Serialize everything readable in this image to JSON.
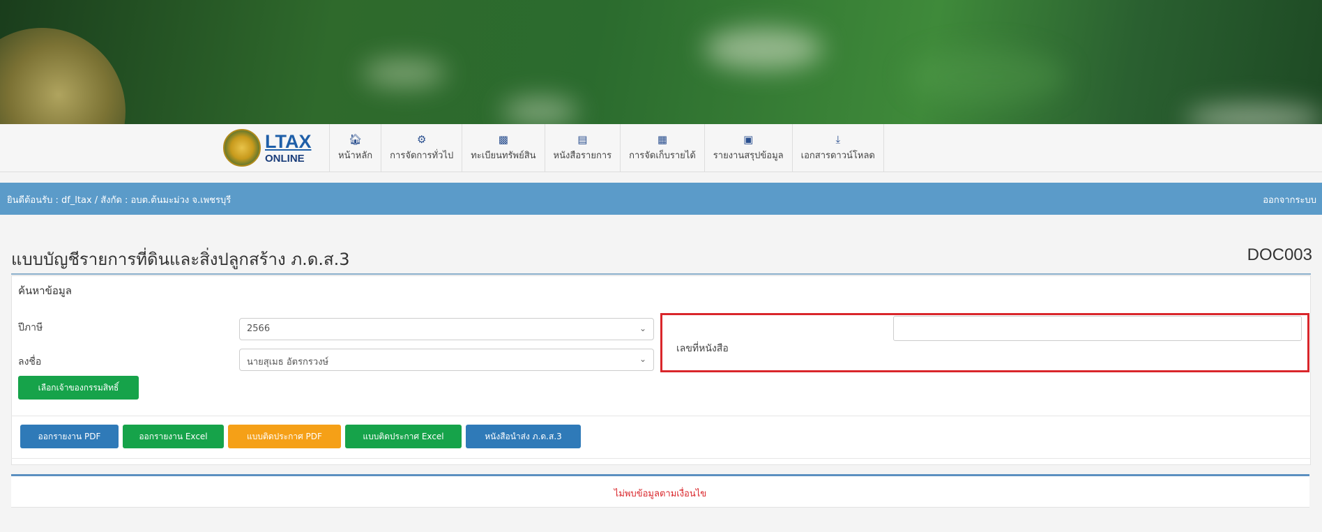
{
  "app": {
    "logo_text": "LTAX",
    "logo_subtext": "ONLINE"
  },
  "nav": {
    "items": [
      {
        "icon": "home-icon",
        "label": "หน้าหลัก"
      },
      {
        "icon": "cogs-icon",
        "label": "การจัดการทั่วไป"
      },
      {
        "icon": "book-icon",
        "label": "ทะเบียนทรัพย์สิน"
      },
      {
        "icon": "document-icon",
        "label": "หนังสือรายการ"
      },
      {
        "icon": "calculator-icon",
        "label": "การจัดเก็บรายได้"
      },
      {
        "icon": "report-icon",
        "label": "รายงานสรุปข้อมูล"
      },
      {
        "icon": "download-icon",
        "label": "เอกสารดาวน์โหลด"
      }
    ]
  },
  "infobar": {
    "welcome": "ยินดีต้อนรับ : df_ltax / สังกัด : อบต.ต้นมะม่วง จ.เพชรบุรี",
    "logout": "ออกจากระบบ"
  },
  "page": {
    "title": "แบบบัญชีรายการที่ดินและสิ่งปลูกสร้าง ภ.ด.ส.3",
    "code": "DOC003"
  },
  "search": {
    "section_title": "ค้นหาข้อมูล",
    "year_label": "ปีภาษี",
    "year_value": "2566",
    "signer_label": "ลงชื่อ",
    "signer_value": "นายสุเมธ อัตรกรวงษ์",
    "doc_no_label": "เลขที่หนังสือ",
    "doc_no_value": "",
    "select_owner_button": "เลือกเจ้าของกรรมสิทธิ์"
  },
  "actions": {
    "report_pdf": "ออกรายงาน PDF",
    "report_excel": "ออกรายงาน Excel",
    "announce_pdf": "แบบติดประกาศ PDF",
    "announce_excel": "แบบติดประกาศ Excel",
    "cover_letter": "หนังสือนำส่ง ภ.ด.ส.3"
  },
  "result": {
    "empty_message": "ไม่พบข้อมูลตามเงื่อนไข"
  },
  "colors": {
    "info_bar": "#5b9bc9",
    "green_button": "#16a34a",
    "blue_button": "#2f7ab8",
    "orange_button": "#f5a017",
    "highlight_box": "#d9262b"
  }
}
